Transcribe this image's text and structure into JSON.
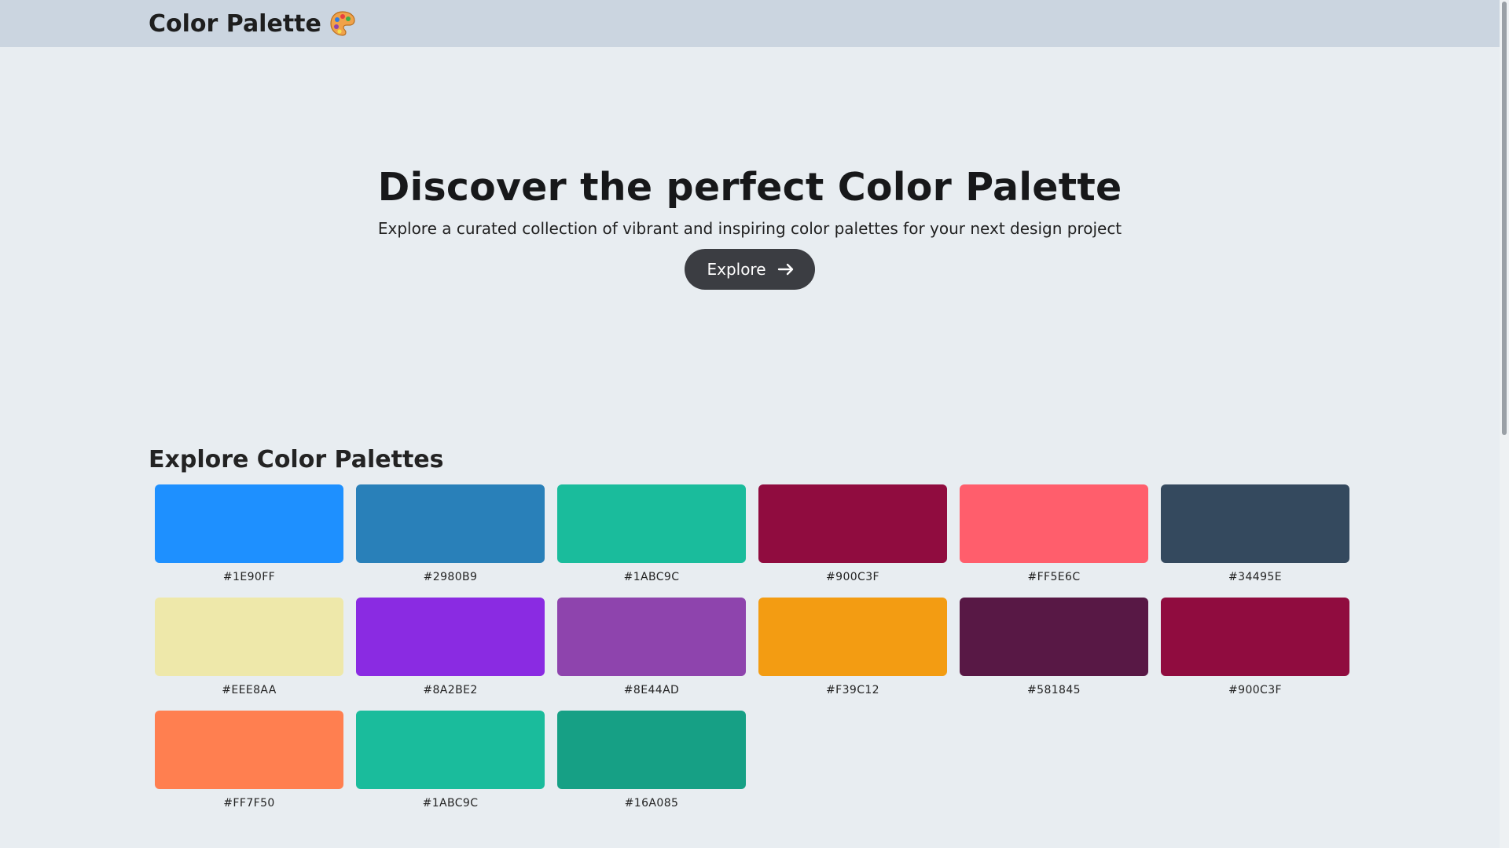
{
  "header": {
    "title": "Color Palette",
    "icon": "palette-icon"
  },
  "hero": {
    "title": "Discover the perfect Color Palette",
    "subtitle": "Explore a curated collection of vibrant and inspiring color palettes for your next design project",
    "button_label": "Explore",
    "button_icon": "arrow-right-icon"
  },
  "section": {
    "title": "Explore Color Palettes"
  },
  "palettes": [
    {
      "label": "#1E90FF",
      "color": "#1E90FF"
    },
    {
      "label": "#2980B9",
      "color": "#2980B9"
    },
    {
      "label": "#1ABC9C",
      "color": "#1ABC9C"
    },
    {
      "label": "#900C3F",
      "color": "#900C3F"
    },
    {
      "label": "#FF5E6C",
      "color": "#FF5E6C"
    },
    {
      "label": "#34495E",
      "color": "#34495E"
    },
    {
      "label": "#EEE8AA",
      "color": "#EEE8AA"
    },
    {
      "label": "#8A2BE2",
      "color": "#8A2BE2"
    },
    {
      "label": "#8E44AD",
      "color": "#8E44AD"
    },
    {
      "label": "#F39C12",
      "color": "#F39C12"
    },
    {
      "label": "#581845",
      "color": "#581845"
    },
    {
      "label": "#900C3F",
      "color": "#900C3F"
    },
    {
      "label": "#FF7F50",
      "color": "#FF7F50"
    },
    {
      "label": "#1ABC9C",
      "color": "#1ABC9C"
    },
    {
      "label": "#16A085",
      "color": "#16A085"
    }
  ]
}
